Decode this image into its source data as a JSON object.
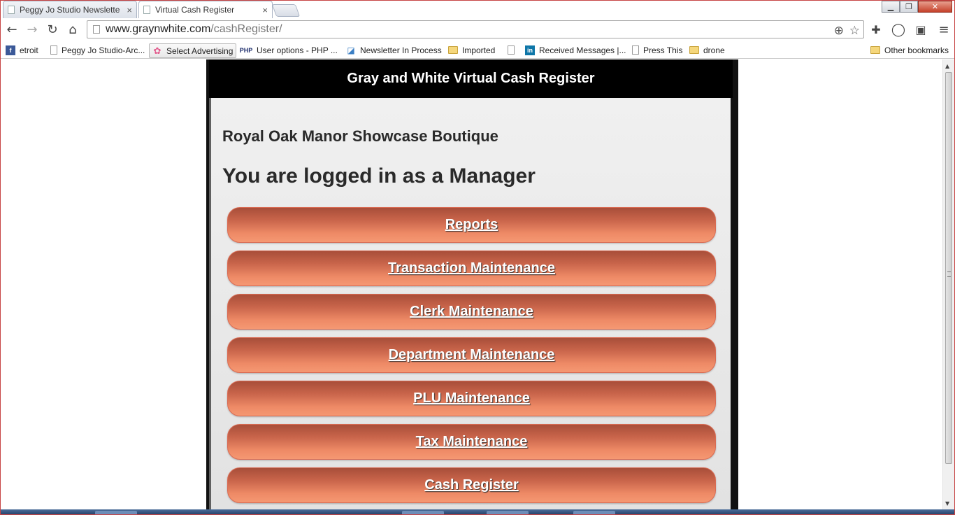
{
  "browser": {
    "tabs": [
      {
        "title": "Peggy Jo Studio Newslette",
        "active": false
      },
      {
        "title": "Virtual Cash Register",
        "active": true
      }
    ],
    "close_glyph": "×",
    "url": {
      "domain": "www.graynwhite.com",
      "path": "/cashRegister/"
    },
    "bookmarks": [
      {
        "label": "etroit",
        "icon": "facebook-icon"
      },
      {
        "label": "Peggy Jo Studio-Arc...",
        "icon": "page-icon"
      },
      {
        "label": "Select Advertising",
        "icon": "ribbon-icon"
      },
      {
        "label": "User options - PHP ...",
        "icon": "php-icon"
      },
      {
        "label": "Newsletter In Process",
        "icon": "chart-icon"
      },
      {
        "label": "Imported",
        "icon": "folder-icon"
      },
      {
        "label": "",
        "icon": "page-icon"
      },
      {
        "label": "Received Messages |...",
        "icon": "linkedin-icon"
      },
      {
        "label": "Press This",
        "icon": "page-icon"
      },
      {
        "label": "drone",
        "icon": "folder-icon"
      },
      {
        "label": "Other bookmarks",
        "icon": "folder-icon"
      }
    ]
  },
  "page": {
    "header_title": "Gray and White Virtual Cash Register",
    "store_name": "Royal Oak Manor Showcase Boutique",
    "login_message": "You are logged in as a Manager",
    "menu": [
      "Reports",
      "Transaction Maintenance",
      "Clerk Maintenance",
      "Department Maintenance",
      "PLU Maintenance",
      "Tax Maintenance",
      "Cash Register"
    ]
  },
  "colors": {
    "button_top": "#a84e39",
    "button_bottom": "#f59872",
    "header_bg": "#000000",
    "panel_bg": "#e8e8e8"
  }
}
